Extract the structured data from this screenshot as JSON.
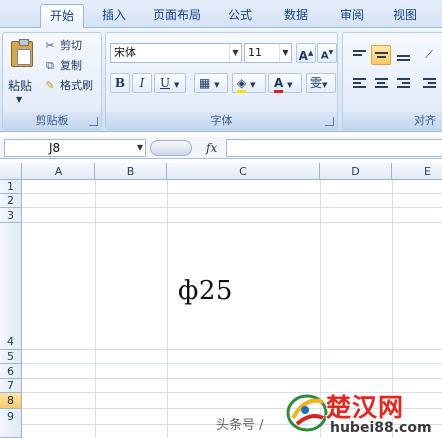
{
  "ribbon": {
    "tabs": [
      "开始",
      "插入",
      "页面布局",
      "公式",
      "数据",
      "审阅",
      "视图"
    ],
    "active_tab": "开始",
    "clipboard": {
      "group_label": "剪贴板",
      "paste": "粘贴",
      "cut": "剪切",
      "copy": "复制",
      "format_painter": "格式刷"
    },
    "font": {
      "group_label": "字体",
      "font_name": "宋体",
      "font_size": "11",
      "bold": "B",
      "italic": "I",
      "underline": "U",
      "grow_font": "A",
      "shrink_font": "A",
      "font_color": "A",
      "phonetic": "雯",
      "font_color_hex": "#e0201b",
      "fill_color_hex": "#ffe000"
    },
    "alignment": {
      "group_label": "对齐"
    }
  },
  "formula_bar": {
    "name_box": "J8",
    "fx": "fx",
    "formula": ""
  },
  "sheet": {
    "columns": [
      "A",
      "B",
      "C",
      "D",
      "E"
    ],
    "rows": [
      "1",
      "2",
      "3",
      "4",
      "5",
      "6",
      "7",
      "8",
      "9"
    ],
    "selected_row": "8",
    "cell_content": "ф25"
  },
  "watermark": {
    "source": "头条号 /",
    "brand_cn": "楚汉网",
    "brand_en": "hubei88.com"
  }
}
